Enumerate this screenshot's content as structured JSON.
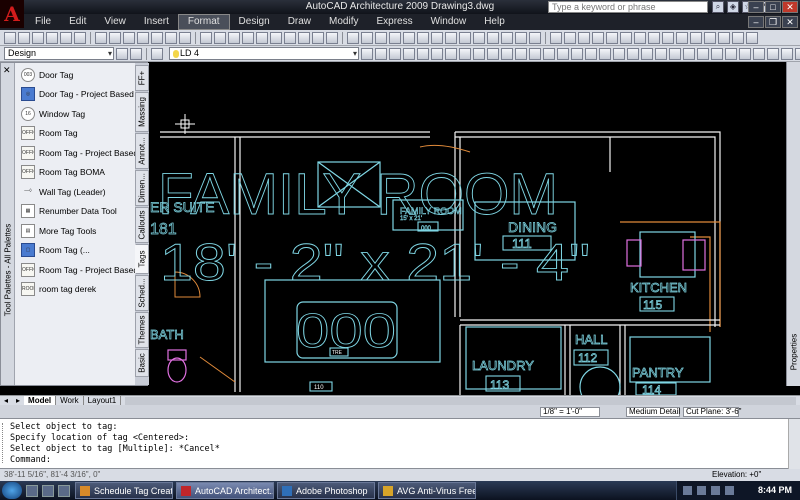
{
  "window": {
    "title": "AutoCAD Architecture 2009 Drawing3.dwg",
    "search_placeholder": "Type a keyword or phrase"
  },
  "menu": [
    "File",
    "Edit",
    "View",
    "Insert",
    "Format",
    "Design",
    "Draw",
    "Modify",
    "Express",
    "Window",
    "Help"
  ],
  "menu_active": "Format",
  "toolbar": {
    "workspace": "Design",
    "layer": "LD 4"
  },
  "palette": {
    "title": "Tool Palettes - All Palettes",
    "close": "✕",
    "items": [
      {
        "label": "Door Tag",
        "icon": "door-tag-icon",
        "glyph": "003"
      },
      {
        "label": "Door Tag - Project Based",
        "icon": "door-tag-project-icon",
        "glyph": "◎"
      },
      {
        "label": "Window Tag",
        "icon": "window-tag-icon",
        "glyph": "16"
      },
      {
        "label": "Room Tag",
        "icon": "room-tag-icon",
        "glyph": "OFFICE"
      },
      {
        "label": "Room Tag - Project Based",
        "icon": "room-tag-project-icon",
        "glyph": "OFFICE"
      },
      {
        "label": "Room Tag BOMA",
        "icon": "room-tag-boma-icon",
        "glyph": "OFFICE"
      },
      {
        "label": "Wall Tag (Leader)",
        "icon": "wall-tag-icon",
        "glyph": "—◊"
      },
      {
        "label": "Renumber Data Tool",
        "icon": "renumber-icon",
        "glyph": "▦"
      },
      {
        "label": "More Tag Tools",
        "icon": "more-tags-icon",
        "glyph": "▤"
      },
      {
        "label": "Room Tag (...",
        "icon": "room-tag-alt-icon",
        "glyph": "▢"
      },
      {
        "label": "Room Tag - Project Based",
        "icon": "room-tag-project-icon-2",
        "glyph": "OFFICE"
      },
      {
        "label": "room tag derek",
        "icon": "room-tag-derek-icon",
        "glyph": "ROOM"
      }
    ],
    "tabs": [
      "FF+",
      "Massing",
      "Annot...",
      "Dimen...",
      "Callouts",
      "Tags",
      "Sched...",
      "Themes",
      "Basic"
    ],
    "active_tab": "Tags"
  },
  "properties_label": "Properties",
  "drawing": {
    "big_label": "FAMILY ROOM",
    "big_dims": "18' - 2\" x 21' - 4\"",
    "suite_label": "ER SUITE",
    "suite_dim": "181",
    "center_tag_label": "FAMILY ROOM",
    "center_tag_dim": "15' x 21'",
    "center_tag_num": "000",
    "dining_label": "DINING",
    "dining_num": "111",
    "kitchen_label": "KITCHEN",
    "kitchen_num": "115",
    "laundry_label": "LAUNDRY",
    "laundry_num": "113",
    "hall_label": "HALL",
    "hall_num": "112",
    "pantry_label": "PANTRY",
    "pantry_num": "114",
    "bath_label": "BATH",
    "box_num": "000",
    "small_tag": "110",
    "fixture_text": "TRE"
  },
  "layout_tabs": [
    "Model",
    "Work",
    "Layout1"
  ],
  "layout_active": "Model",
  "drawing_status": {
    "scale": "1/8\" = 1'-0\"",
    "detail": "Medium Detail",
    "cut_plane": "Cut Plane: 3'-6\""
  },
  "command_lines": [
    "Select object to tag:",
    "Specify location of tag <Centered>:",
    "Select object to tag [Multiple]: *Cancel*",
    "Command:"
  ],
  "status": {
    "coords": "38'-11 5/16\", 81'-4 3/16\", 0\"",
    "elevation": "Elevation: +0\""
  },
  "taskbar": {
    "tasks": [
      {
        "label": "Schedule Tag Creat...",
        "icon": "browser-icon",
        "color": "#d88a2a"
      },
      {
        "label": "AutoCAD Architect...",
        "icon": "autocad-icon",
        "color": "#c0262b"
      },
      {
        "label": "Adobe Photoshop",
        "icon": "photoshop-icon",
        "color": "#2f6fb8"
      },
      {
        "label": "AVG Anti-Virus Free",
        "icon": "avg-icon",
        "color": "#d7a429"
      }
    ],
    "active_task": 1,
    "clock": "8:44 PM"
  },
  "colors": {
    "canvas": "#000000",
    "walls": "#f2f2f2",
    "tags": "#7fd6e4",
    "fixtures": "#e070e0",
    "accent_orange": "#e08a3a"
  }
}
